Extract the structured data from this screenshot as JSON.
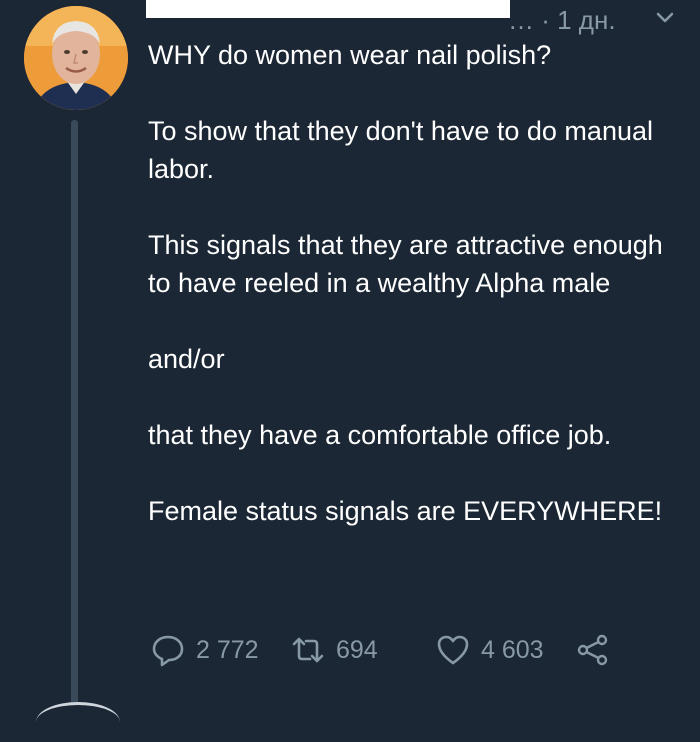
{
  "tweet": {
    "header_tail": "… · 1 дн.",
    "paragraphs": [
      "WHY do women wear nail polish?",
      "To show that they don't have to do manual labor.",
      "This signals that they are attractive enough to have reeled in a wealthy Alpha male",
      "and/or",
      "that they have a comfortable office job.",
      "Female status signals are EVERYWHERE!"
    ]
  },
  "actions": {
    "replies": "2 772",
    "retweets": "694",
    "likes": "4 603"
  },
  "icons": {
    "reply": "speech-bubble-icon",
    "retweet": "retweet-arrows-icon",
    "like": "heart-icon",
    "share": "share-icon",
    "menu": "chevron-down-icon"
  },
  "colors": {
    "background": "#1b2734",
    "text": "#ffffff",
    "muted": "#8899a6",
    "thread_line": "#394a5b"
  }
}
